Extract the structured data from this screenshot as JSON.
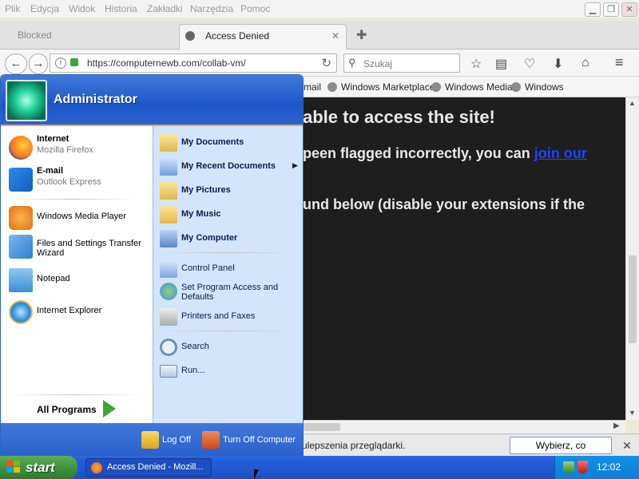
{
  "menubar": {
    "items": [
      "Plik",
      "Edycja",
      "Widok",
      "Historia",
      "Zakładki",
      "Narzędzia",
      "Pomoc"
    ]
  },
  "tabs": [
    {
      "label": "Blocked",
      "active": false
    },
    {
      "label": "Access Denied",
      "active": true
    }
  ],
  "navbar": {
    "url": "https://computernewb.com/collab-vm/",
    "search_placeholder": "Szukaj"
  },
  "bookmarks": [
    "mail",
    "Windows Marketplace",
    "Windows Media",
    "Windows"
  ],
  "page": {
    "line1": "able to access the site!",
    "line2_text": "peen flagged incorrectly, you can ",
    "line2_link": "join our",
    "line3": "und below (disable your extensions if the"
  },
  "notification": {
    "text": "ulepszenia przeglądarki.",
    "button": "Wybierz, co udostępniać"
  },
  "start_menu": {
    "user": "Administrator",
    "left_items": [
      {
        "title": "Internet",
        "subtitle": "Mozilla Firefox",
        "icon": "firefox-icon"
      },
      {
        "title": "E-mail",
        "subtitle": "Outlook Express",
        "icon": "outlook-icon"
      },
      {
        "title": "Windows Media Player",
        "icon": "media-player-icon"
      },
      {
        "title": "Files and Settings Transfer Wizard",
        "icon": "transfer-wizard-icon"
      },
      {
        "title": "Notepad",
        "icon": "notepad-icon"
      },
      {
        "title": "Internet Explorer",
        "icon": "internet-explorer-icon"
      }
    ],
    "all_programs": "All Programs",
    "right_items": [
      {
        "label": "My Documents",
        "bold": true,
        "icon": "folder-icon"
      },
      {
        "label": "My Recent Documents",
        "bold": true,
        "icon": "recent-documents-icon"
      },
      {
        "label": "My Pictures",
        "bold": true,
        "icon": "folder-icon"
      },
      {
        "label": "My Music",
        "bold": true,
        "icon": "folder-icon"
      },
      {
        "label": "My Computer",
        "bold": true,
        "icon": "computer-icon"
      },
      {
        "label": "Control Panel",
        "bold": false,
        "icon": "control-panel-icon"
      },
      {
        "label": "Set Program Access and Defaults",
        "bold": false,
        "icon": "program-access-icon"
      },
      {
        "label": "Printers and Faxes",
        "bold": false,
        "icon": "printer-icon"
      },
      {
        "label": "Search",
        "bold": false,
        "icon": "search-icon"
      },
      {
        "label": "Run...",
        "bold": false,
        "icon": "run-icon"
      }
    ],
    "log_off": "Log Off",
    "turn_off": "Turn Off Computer"
  },
  "taskbar": {
    "start": "start",
    "task": "Access Denied - Mozill...",
    "clock": "12:02"
  },
  "colors": {
    "xp_blue": "#245edb",
    "start_green": "#3c8e3c",
    "page_bg": "#1e1e1e",
    "link": "#1d44ff"
  }
}
